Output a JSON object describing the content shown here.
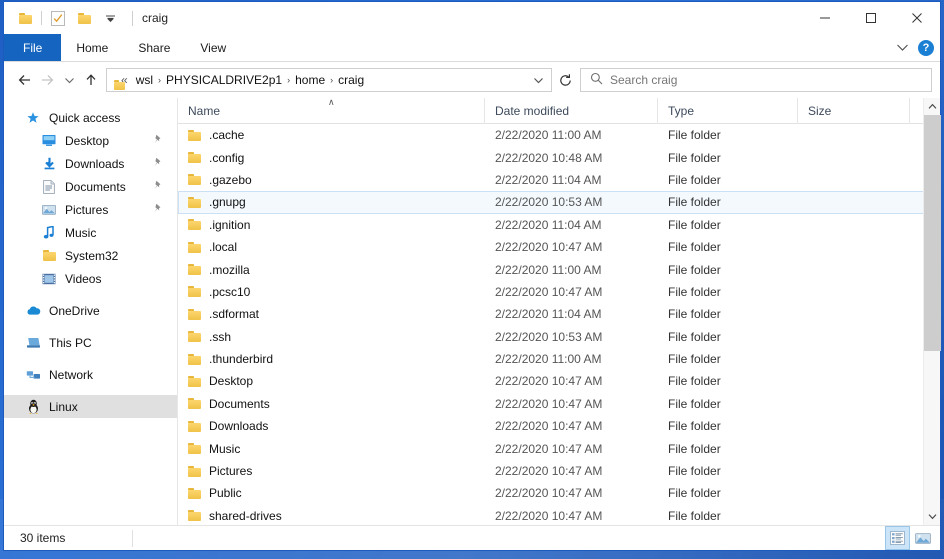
{
  "window": {
    "title": "craig",
    "quick_access_toolbar": [
      {
        "name": "folder-icon",
        "label": "Explorer"
      },
      {
        "name": "properties-icon",
        "label": "Properties"
      },
      {
        "name": "new-folder-icon",
        "label": "New folder"
      },
      {
        "name": "customize-dropdown-icon",
        "label": "Customize Quick Access Toolbar"
      }
    ],
    "controls": {
      "minimize": "—",
      "maximize": "□",
      "close": "✕"
    }
  },
  "ribbon": {
    "tabs": [
      {
        "label": "File",
        "active": true
      },
      {
        "label": "Home",
        "active": false
      },
      {
        "label": "Share",
        "active": false
      },
      {
        "label": "View",
        "active": false
      }
    ],
    "collapse_icon": "chevron-down-icon",
    "help_label": "?"
  },
  "address_bar": {
    "back_icon": "←",
    "forward_icon": "→",
    "recent_icon": "∨",
    "up_icon": "↑",
    "overflow": "«",
    "breadcrumbs": [
      "wsl",
      "PHYSICALDRIVE2p1",
      "home",
      "craig"
    ],
    "separator": "›",
    "dropdown_icon": "∨",
    "refresh_icon": "↻",
    "refresh_label": "Refresh"
  },
  "search": {
    "placeholder": "Search craig",
    "icon": "search-icon"
  },
  "sidebar": {
    "groups": [
      {
        "header": {
          "label": "Quick access",
          "icon": "star-pin-icon"
        },
        "items": [
          {
            "label": "Desktop",
            "icon": "desktop-icon",
            "pinned": true
          },
          {
            "label": "Downloads",
            "icon": "download-icon",
            "pinned": true
          },
          {
            "label": "Documents",
            "icon": "document-icon",
            "pinned": true
          },
          {
            "label": "Pictures",
            "icon": "pictures-icon",
            "pinned": true
          },
          {
            "label": "Music",
            "icon": "music-note-icon",
            "pinned": false
          },
          {
            "label": "System32",
            "icon": "folder-icon",
            "pinned": false
          },
          {
            "label": "Videos",
            "icon": "video-filmstrip-icon",
            "pinned": false
          }
        ]
      },
      {
        "header": {
          "label": "OneDrive",
          "icon": "cloud-icon"
        },
        "items": []
      },
      {
        "header": {
          "label": "This PC",
          "icon": "this-pc-icon"
        },
        "items": []
      },
      {
        "header": {
          "label": "Network",
          "icon": "network-icon"
        },
        "items": []
      },
      {
        "header": {
          "label": "Linux",
          "icon": "tux-penguin-icon",
          "selected": true
        },
        "items": []
      }
    ],
    "pin_glyph": "📌"
  },
  "file_list": {
    "columns": [
      {
        "key": "name",
        "label": "Name",
        "sorted": true,
        "sort_glyph": "∧"
      },
      {
        "key": "date",
        "label": "Date modified"
      },
      {
        "key": "type",
        "label": "Type"
      },
      {
        "key": "size",
        "label": "Size"
      }
    ],
    "rows": [
      {
        "name": ".cache",
        "date": "2/22/2020 11:00 AM",
        "type": "File folder",
        "size": "",
        "selected": false
      },
      {
        "name": ".config",
        "date": "2/22/2020 10:48 AM",
        "type": "File folder",
        "size": "",
        "selected": false
      },
      {
        "name": ".gazebo",
        "date": "2/22/2020 11:04 AM",
        "type": "File folder",
        "size": "",
        "selected": false
      },
      {
        "name": ".gnupg",
        "date": "2/22/2020 10:53 AM",
        "type": "File folder",
        "size": "",
        "selected": true
      },
      {
        "name": ".ignition",
        "date": "2/22/2020 11:04 AM",
        "type": "File folder",
        "size": "",
        "selected": false
      },
      {
        "name": ".local",
        "date": "2/22/2020 10:47 AM",
        "type": "File folder",
        "size": "",
        "selected": false
      },
      {
        "name": ".mozilla",
        "date": "2/22/2020 11:00 AM",
        "type": "File folder",
        "size": "",
        "selected": false
      },
      {
        "name": ".pcsc10",
        "date": "2/22/2020 10:47 AM",
        "type": "File folder",
        "size": "",
        "selected": false
      },
      {
        "name": ".sdformat",
        "date": "2/22/2020 11:04 AM",
        "type": "File folder",
        "size": "",
        "selected": false
      },
      {
        "name": ".ssh",
        "date": "2/22/2020 10:53 AM",
        "type": "File folder",
        "size": "",
        "selected": false
      },
      {
        "name": ".thunderbird",
        "date": "2/22/2020 11:00 AM",
        "type": "File folder",
        "size": "",
        "selected": false
      },
      {
        "name": "Desktop",
        "date": "2/22/2020 10:47 AM",
        "type": "File folder",
        "size": "",
        "selected": false
      },
      {
        "name": "Documents",
        "date": "2/22/2020 10:47 AM",
        "type": "File folder",
        "size": "",
        "selected": false
      },
      {
        "name": "Downloads",
        "date": "2/22/2020 10:47 AM",
        "type": "File folder",
        "size": "",
        "selected": false
      },
      {
        "name": "Music",
        "date": "2/22/2020 10:47 AM",
        "type": "File folder",
        "size": "",
        "selected": false
      },
      {
        "name": "Pictures",
        "date": "2/22/2020 10:47 AM",
        "type": "File folder",
        "size": "",
        "selected": false
      },
      {
        "name": "Public",
        "date": "2/22/2020 10:47 AM",
        "type": "File folder",
        "size": "",
        "selected": false
      },
      {
        "name": "shared-drives",
        "date": "2/22/2020 10:47 AM",
        "type": "File folder",
        "size": "",
        "selected": false
      }
    ]
  },
  "scrollbar": {
    "up_arrow": "∧",
    "down_arrow": "∨",
    "thumb_position_pct": 0,
    "thumb_size_pct": 60
  },
  "status_bar": {
    "item_count": "30 items",
    "views": [
      {
        "name": "details-view-button",
        "active": true
      },
      {
        "name": "large-icons-view-button",
        "active": false
      }
    ]
  },
  "colors": {
    "accent": "#1565c0",
    "folder_yellow": "#f0c248",
    "selection_fill": "#f4f9fe",
    "selection_border": "#cce0f5",
    "sidebar_selection": "#e0e0e0",
    "desktop_blue": "#2a6fd4"
  }
}
